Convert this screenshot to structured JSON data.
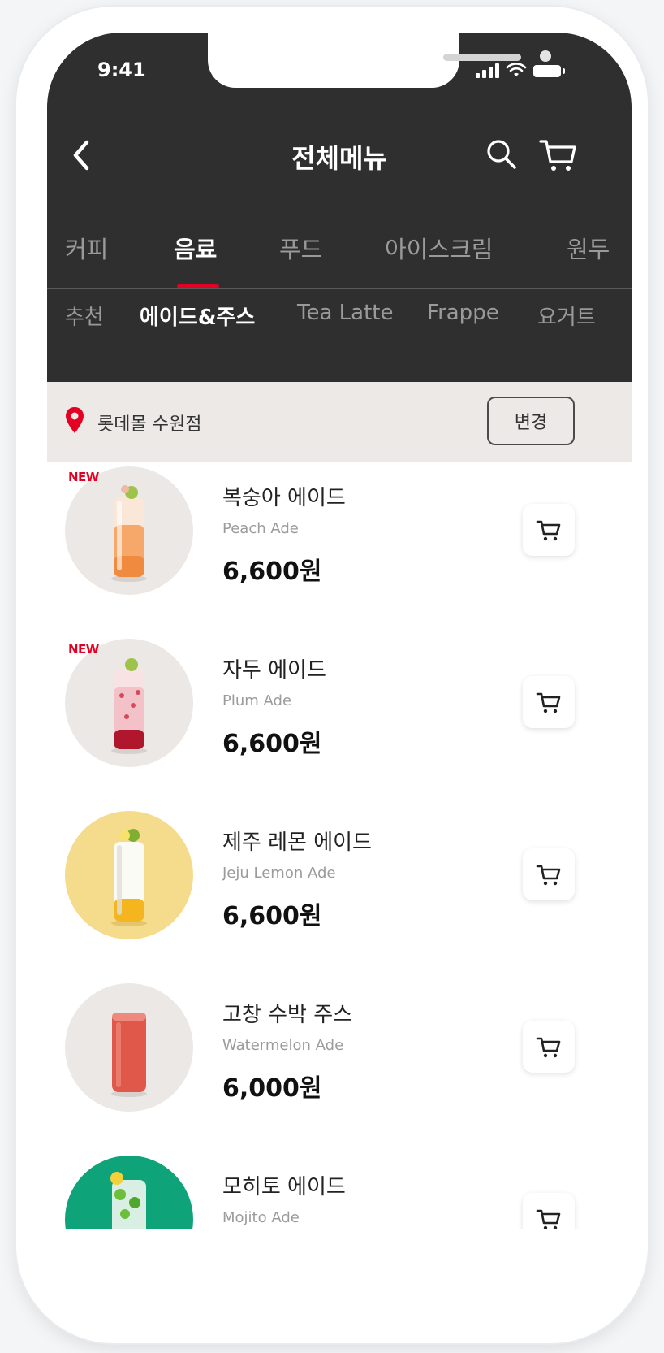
{
  "status_bar": {
    "time": "9:41"
  },
  "header": {
    "title": "전체메뉴"
  },
  "category_tabs": [
    {
      "label": "커피"
    },
    {
      "label": "음료"
    },
    {
      "label": "푸드"
    },
    {
      "label": "아이스크림"
    },
    {
      "label": "원두"
    }
  ],
  "active_category": "음료",
  "sub_tabs": [
    {
      "label": "추천"
    },
    {
      "label": "에이드&주스"
    },
    {
      "label": "Tea Latte"
    },
    {
      "label": "Frappe"
    },
    {
      "label": "요거트"
    }
  ],
  "active_sub_tab": "에이드&주스",
  "store": {
    "name": "롯데몰 수원점",
    "change_label": "변경"
  },
  "products": [
    {
      "badge": "NEW",
      "name": "복숭아 에이드",
      "eng": "Peach Ade",
      "price": "6,600원",
      "thumb_bg": "#ece8e5"
    },
    {
      "badge": "NEW",
      "name": "자두 에이드",
      "eng": "Plum Ade",
      "price": "6,600원",
      "thumb_bg": "#ece8e5"
    },
    {
      "badge": "",
      "name": "제주 레몬 에이드",
      "eng": "Jeju Lemon Ade",
      "price": "6,600원",
      "thumb_bg": "#f5dc8c"
    },
    {
      "badge": "",
      "name": "고창 수박 주스",
      "eng": "Watermelon Ade",
      "price": "6,000원",
      "thumb_bg": "#ece8e5"
    },
    {
      "badge": "",
      "name": "모히토 에이드",
      "eng": "Mojito Ade",
      "price": "",
      "thumb_bg": "#0fa37a"
    }
  ],
  "colors": {
    "header_bg": "#2f2f2f",
    "accent": "#e30022",
    "store_bar_bg": "#ede9e6"
  }
}
